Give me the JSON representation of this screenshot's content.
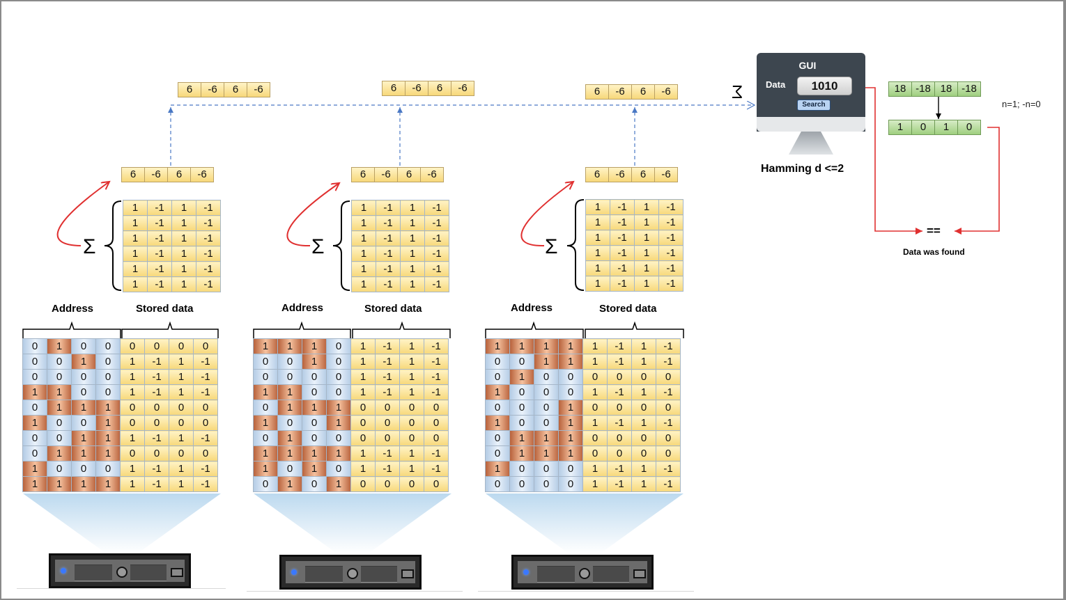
{
  "column_headers": {
    "address": "Address",
    "stored": "Stored data"
  },
  "sigma": "Σ",
  "columns": [
    {
      "top_vector": [
        "6",
        "-6",
        "6",
        "-6"
      ],
      "sum_vector": [
        "6",
        "-6",
        "6",
        "-6"
      ],
      "hard_locations": [
        [
          "1",
          "-1",
          "1",
          "-1"
        ],
        [
          "1",
          "-1",
          "1",
          "-1"
        ],
        [
          "1",
          "-1",
          "1",
          "-1"
        ],
        [
          "1",
          "-1",
          "1",
          "-1"
        ],
        [
          "1",
          "-1",
          "1",
          "-1"
        ],
        [
          "1",
          "-1",
          "1",
          "-1"
        ]
      ],
      "rows": [
        {
          "address": [
            "0",
            "1",
            "0",
            "0"
          ],
          "stored": [
            "0",
            "0",
            "0",
            "0"
          ]
        },
        {
          "address": [
            "0",
            "0",
            "1",
            "0"
          ],
          "stored": [
            "1",
            "-1",
            "1",
            "-1"
          ]
        },
        {
          "address": [
            "0",
            "0",
            "0",
            "0"
          ],
          "stored": [
            "1",
            "-1",
            "1",
            "-1"
          ]
        },
        {
          "address": [
            "1",
            "1",
            "0",
            "0"
          ],
          "stored": [
            "1",
            "-1",
            "1",
            "-1"
          ]
        },
        {
          "address": [
            "0",
            "1",
            "1",
            "1"
          ],
          "stored": [
            "0",
            "0",
            "0",
            "0"
          ]
        },
        {
          "address": [
            "1",
            "0",
            "0",
            "1"
          ],
          "stored": [
            "0",
            "0",
            "0",
            "0"
          ]
        },
        {
          "address": [
            "0",
            "0",
            "1",
            "1"
          ],
          "stored": [
            "1",
            "-1",
            "1",
            "-1"
          ]
        },
        {
          "address": [
            "0",
            "1",
            "1",
            "1"
          ],
          "stored": [
            "0",
            "0",
            "0",
            "0"
          ]
        },
        {
          "address": [
            "1",
            "0",
            "0",
            "0"
          ],
          "stored": [
            "1",
            "-1",
            "1",
            "-1"
          ]
        },
        {
          "address": [
            "1",
            "1",
            "1",
            "1"
          ],
          "stored": [
            "1",
            "-1",
            "1",
            "-1"
          ]
        }
      ]
    },
    {
      "top_vector": [
        "6",
        "-6",
        "6",
        "-6"
      ],
      "sum_vector": [
        "6",
        "-6",
        "6",
        "-6"
      ],
      "hard_locations": [
        [
          "1",
          "-1",
          "1",
          "-1"
        ],
        [
          "1",
          "-1",
          "1",
          "-1"
        ],
        [
          "1",
          "-1",
          "1",
          "-1"
        ],
        [
          "1",
          "-1",
          "1",
          "-1"
        ],
        [
          "1",
          "-1",
          "1",
          "-1"
        ],
        [
          "1",
          "-1",
          "1",
          "-1"
        ]
      ],
      "rows": [
        {
          "address": [
            "1",
            "1",
            "1",
            "0"
          ],
          "stored": [
            "1",
            "-1",
            "1",
            "-1"
          ]
        },
        {
          "address": [
            "0",
            "0",
            "1",
            "0"
          ],
          "stored": [
            "1",
            "-1",
            "1",
            "-1"
          ]
        },
        {
          "address": [
            "0",
            "0",
            "0",
            "0"
          ],
          "stored": [
            "1",
            "-1",
            "1",
            "-1"
          ]
        },
        {
          "address": [
            "1",
            "1",
            "0",
            "0"
          ],
          "stored": [
            "1",
            "-1",
            "1",
            "-1"
          ]
        },
        {
          "address": [
            "0",
            "1",
            "1",
            "1"
          ],
          "stored": [
            "0",
            "0",
            "0",
            "0"
          ]
        },
        {
          "address": [
            "1",
            "0",
            "0",
            "1"
          ],
          "stored": [
            "0",
            "0",
            "0",
            "0"
          ]
        },
        {
          "address": [
            "0",
            "1",
            "0",
            "0"
          ],
          "stored": [
            "0",
            "0",
            "0",
            "0"
          ]
        },
        {
          "address": [
            "1",
            "1",
            "1",
            "1"
          ],
          "stored": [
            "1",
            "-1",
            "1",
            "-1"
          ]
        },
        {
          "address": [
            "1",
            "0",
            "1",
            "0"
          ],
          "stored": [
            "1",
            "-1",
            "1",
            "-1"
          ]
        },
        {
          "address": [
            "0",
            "1",
            "0",
            "1"
          ],
          "stored": [
            "0",
            "0",
            "0",
            "0"
          ]
        }
      ]
    },
    {
      "top_vector": [
        "6",
        "-6",
        "6",
        "-6"
      ],
      "sum_vector": [
        "6",
        "-6",
        "6",
        "-6"
      ],
      "hard_locations": [
        [
          "1",
          "-1",
          "1",
          "-1"
        ],
        [
          "1",
          "-1",
          "1",
          "-1"
        ],
        [
          "1",
          "-1",
          "1",
          "-1"
        ],
        [
          "1",
          "-1",
          "1",
          "-1"
        ],
        [
          "1",
          "-1",
          "1",
          "-1"
        ],
        [
          "1",
          "-1",
          "1",
          "-1"
        ]
      ],
      "rows": [
        {
          "address": [
            "1",
            "1",
            "1",
            "1"
          ],
          "stored": [
            "1",
            "-1",
            "1",
            "-1"
          ]
        },
        {
          "address": [
            "0",
            "0",
            "1",
            "1"
          ],
          "stored": [
            "1",
            "-1",
            "1",
            "-1"
          ]
        },
        {
          "address": [
            "0",
            "1",
            "0",
            "0"
          ],
          "stored": [
            "0",
            "0",
            "0",
            "0"
          ]
        },
        {
          "address": [
            "1",
            "0",
            "0",
            "0"
          ],
          "stored": [
            "1",
            "-1",
            "1",
            "-1"
          ]
        },
        {
          "address": [
            "0",
            "0",
            "0",
            "1"
          ],
          "stored": [
            "0",
            "0",
            "0",
            "0"
          ]
        },
        {
          "address": [
            "1",
            "0",
            "0",
            "1"
          ],
          "stored": [
            "1",
            "-1",
            "1",
            "-1"
          ]
        },
        {
          "address": [
            "0",
            "1",
            "1",
            "1"
          ],
          "stored": [
            "0",
            "0",
            "0",
            "0"
          ]
        },
        {
          "address": [
            "0",
            "1",
            "1",
            "1"
          ],
          "stored": [
            "0",
            "0",
            "0",
            "0"
          ]
        },
        {
          "address": [
            "1",
            "0",
            "0",
            "0"
          ],
          "stored": [
            "1",
            "-1",
            "1",
            "-1"
          ]
        },
        {
          "address": [
            "0",
            "0",
            "0",
            "0"
          ],
          "stored": [
            "1",
            "-1",
            "1",
            "-1"
          ]
        }
      ]
    }
  ],
  "gui": {
    "title": "GUI",
    "data_label": "Data",
    "data_value": "1010",
    "search_label": "Search",
    "hamming_text": "Hamming  d <=2",
    "aggregate_symbol": "Σ"
  },
  "result": {
    "sum_vector": [
      "18",
      "-18",
      "18",
      "-18"
    ],
    "rule_text": "n=1;  -n=0",
    "binary_vector": [
      "1",
      "0",
      "1",
      "0"
    ],
    "equals_symbol": "==",
    "found_text": "Data was found"
  },
  "colors": {
    "address_one": "#d9895f",
    "address_zero": "#d7e5f4",
    "stored_cell": "#f9e29a",
    "result_cell": "#b8dca0",
    "red_arrow": "#e03030",
    "dashed_arrow": "#4a78c4",
    "monitor": "#3d464f"
  }
}
